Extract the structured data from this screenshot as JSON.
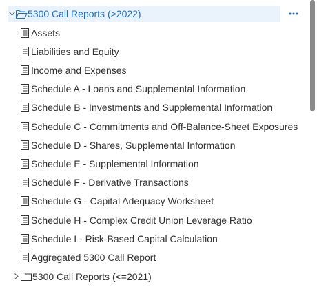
{
  "tree": {
    "parent": {
      "label": "5300 Call Reports (>2022)",
      "expanded": true,
      "chevron_icon": "chevron-down-icon",
      "folder_icon": "folder-open-icon",
      "more_label": "…"
    },
    "children": [
      {
        "label": "Assets",
        "icon": "document-icon"
      },
      {
        "label": "Liabilities and Equity",
        "icon": "document-icon"
      },
      {
        "label": "Income and Expenses",
        "icon": "document-icon"
      },
      {
        "label": "Schedule A - Loans and Supplemental Information",
        "icon": "document-icon"
      },
      {
        "label": "Schedule B - Investments and Supplemental Information",
        "icon": "document-icon"
      },
      {
        "label": "Schedule C - Commitments and Off-Balance-Sheet Exposures",
        "icon": "document-icon"
      },
      {
        "label": "Schedule D - Shares, Supplemental Information",
        "icon": "document-icon"
      },
      {
        "label": "Schedule E - Supplemental Information",
        "icon": "document-icon"
      },
      {
        "label": "Schedule F - Derivative Transactions",
        "icon": "document-icon"
      },
      {
        "label": "Schedule G - Capital Adequacy Worksheet",
        "icon": "document-icon"
      },
      {
        "label": "Schedule H - Complex Credit Union Leverage Ratio",
        "icon": "document-icon"
      },
      {
        "label": "Schedule I - Risk-Based Capital Calculation",
        "icon": "document-icon"
      },
      {
        "label": "Aggregated 5300 Call Report",
        "icon": "document-icon"
      }
    ],
    "next_folder": {
      "label": "5300 Call Reports (<=2021)",
      "expanded": false,
      "chevron_icon": "chevron-right-icon",
      "folder_icon": "folder-closed-icon"
    }
  },
  "colors": {
    "accent": "#1a6fc5",
    "selected_bg": "#eaf3fc",
    "text": "#323130",
    "scrollbar": "#8a8a8a"
  }
}
